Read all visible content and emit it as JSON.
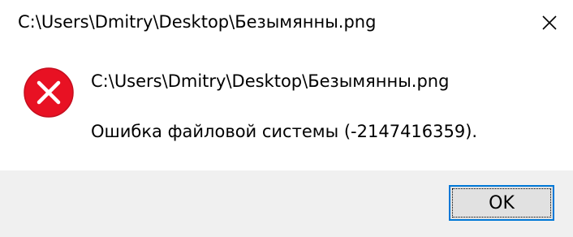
{
  "window": {
    "title": "C:\\Users\\Dmitry\\Desktop\\Безымянны.png"
  },
  "message": {
    "path": "C:\\Users\\Dmitry\\Desktop\\Безымянны.png",
    "error": "Ошибка файловой системы (-2147416359)."
  },
  "buttons": {
    "ok_label": "OK"
  },
  "icons": {
    "close": "close-icon",
    "error": "error-icon"
  },
  "colors": {
    "error_icon": "#e81123",
    "button_border": "#0078d7",
    "button_bg": "#e1e1e1",
    "footer_bg": "#f0f0f0"
  }
}
